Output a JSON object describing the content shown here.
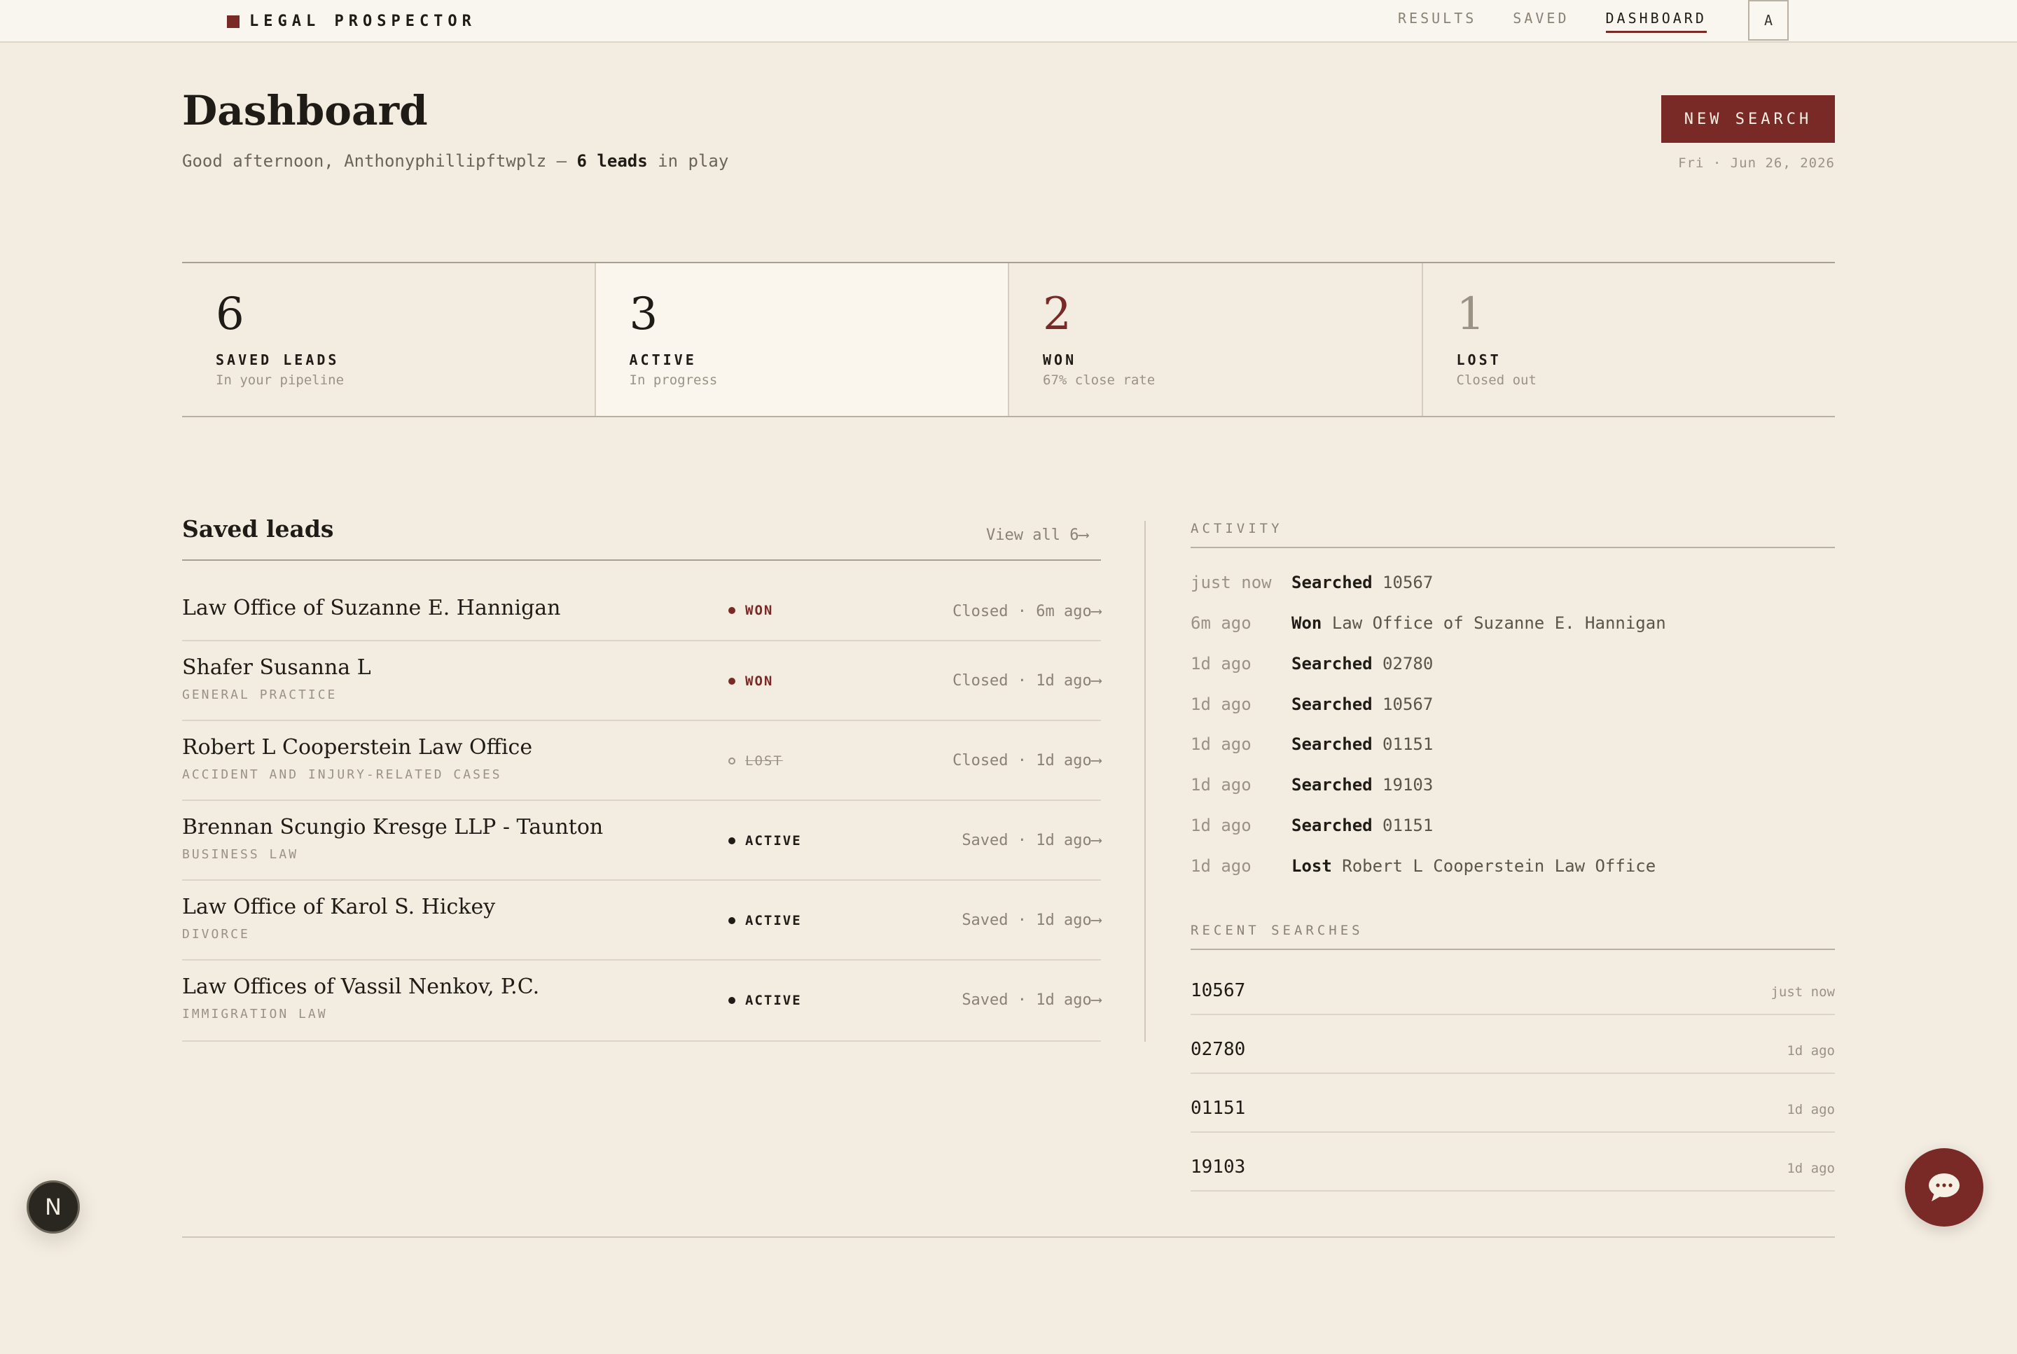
{
  "brand": {
    "name": "LEGAL PROSPECTOR"
  },
  "nav": {
    "items": [
      {
        "label": "RESULTS"
      },
      {
        "label": "SAVED"
      },
      {
        "label": "DASHBOARD"
      }
    ],
    "avatar_initial": "A"
  },
  "header": {
    "title": "Dashboard",
    "greeting_prefix": "Good afternoon, Anthonyphillipftwplz —",
    "greeting_count": "6 leads",
    "greeting_suffix": "in play",
    "new_search_label": "NEW SEARCH",
    "date": "Fri · Jun 26, 2026"
  },
  "stats": [
    {
      "value": "6",
      "label": "SAVED LEADS",
      "sub": "In your pipeline",
      "color": "#1f1c17"
    },
    {
      "value": "3",
      "label": "ACTIVE",
      "sub": "In progress",
      "color": "#1f1c17"
    },
    {
      "value": "2",
      "label": "WON",
      "sub": "67% close rate",
      "color": "#7a2a26"
    },
    {
      "value": "1",
      "label": "LOST",
      "sub": "Closed out",
      "color": "#9a9284"
    }
  ],
  "leads": {
    "title": "Saved leads",
    "view_all": "View all 6⟶",
    "rows": [
      {
        "name": "Law Office of Suzanne E. Hannigan",
        "category": "",
        "status": "WON",
        "when": "Closed · 6m ago⟶"
      },
      {
        "name": "Shafer Susanna L",
        "category": "GENERAL PRACTICE",
        "status": "WON",
        "when": "Closed · 1d ago⟶"
      },
      {
        "name": "Robert L Cooperstein Law Office",
        "category": "ACCIDENT AND INJURY-RELATED CASES",
        "status": "LOST",
        "when": "Closed · 1d ago⟶"
      },
      {
        "name": "Brennan Scungio Kresge LLP - Taunton",
        "category": "BUSINESS LAW",
        "status": "ACTIVE",
        "when": "Saved · 1d ago⟶"
      },
      {
        "name": "Law Office of Karol S. Hickey",
        "category": "DIVORCE",
        "status": "ACTIVE",
        "when": "Saved · 1d ago⟶"
      },
      {
        "name": "Law Offices of Vassil Nenkov, P.C.",
        "category": "IMMIGRATION LAW",
        "status": "ACTIVE",
        "when": "Saved · 1d ago⟶"
      }
    ]
  },
  "activity": {
    "label": "ACTIVITY",
    "rows": [
      {
        "time": "just now",
        "verb": "Searched",
        "object": "10567"
      },
      {
        "time": "6m ago",
        "verb": "Won",
        "object": "Law Office of Suzanne E. Hannigan"
      },
      {
        "time": "1d ago",
        "verb": "Searched",
        "object": "02780"
      },
      {
        "time": "1d ago",
        "verb": "Searched",
        "object": "10567"
      },
      {
        "time": "1d ago",
        "verb": "Searched",
        "object": "01151"
      },
      {
        "time": "1d ago",
        "verb": "Searched",
        "object": "19103"
      },
      {
        "time": "1d ago",
        "verb": "Searched",
        "object": "01151"
      },
      {
        "time": "1d ago",
        "verb": "Lost",
        "object": "Robert L Cooperstein Law Office"
      }
    ]
  },
  "recent_searches": {
    "label": "RECENT SEARCHES",
    "rows": [
      {
        "zip": "10567",
        "time": "just now"
      },
      {
        "zip": "02780",
        "time": "1d ago"
      },
      {
        "zip": "01151",
        "time": "1d ago"
      },
      {
        "zip": "19103",
        "time": "1d ago"
      }
    ]
  },
  "widgets": {
    "dev_badge": "N",
    "chat_icon": "chat-bubble-icon"
  }
}
